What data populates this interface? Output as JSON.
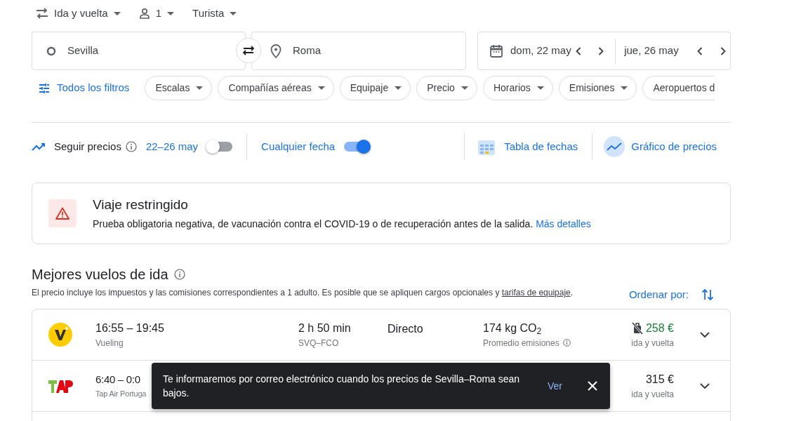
{
  "trip_options": [
    {
      "kind": "trip",
      "label": "Ida y vuelta"
    },
    {
      "kind": "passengers",
      "label": "1"
    },
    {
      "kind": "class",
      "label": "Turista"
    }
  ],
  "origin": {
    "value": "Sevilla"
  },
  "destination": {
    "value": "Roma"
  },
  "dates": {
    "departure": "dom, 22 may",
    "return": "jue, 26 may"
  },
  "filters": {
    "all_filters": "Todos los filtros",
    "chips": [
      "Escalas",
      "Compañías aéreas",
      "Equipaje",
      "Precio",
      "Horarios",
      "Emisiones",
      "Aeropuertos d"
    ]
  },
  "tracking": {
    "label": "Seguir precios",
    "dates": "22–26 may",
    "on": false
  },
  "any_date": {
    "label": "Cualquier fecha",
    "on": true
  },
  "date_grid": "Tabla de fechas",
  "price_graph": "Gráfico de precios",
  "alert": {
    "title": "Viaje restringido",
    "text": "Prueba obligatoria negativa, de vacunación contra el COVID-19 o de recuperación antes de la salida.",
    "link": "Más detalles"
  },
  "section": {
    "title": "Mejores vuelos de ida",
    "note": "El precio incluye los impuestos y las comisiones correspondientes a 1 adulto. Es posible que se apliquen cargos opcionales y",
    "note_link": "tarifas de equipaje",
    "note_end": ".",
    "sort_label": "Ordenar por:"
  },
  "flights": [
    {
      "kind": "badge",
      "times": "16:55 – 19:45",
      "airline": "Vueling",
      "duration": "2 h 50 min",
      "route": "SVQ–FCO",
      "stops": "Directo",
      "emissions": "174 kg CO$_{2}$",
      "emissions_note": "Promedio emisiones",
      "no_bag": true,
      "price_low": true,
      "price": "258 €",
      "price_note": "ida y vuelta"
    },
    {
      "kind": "wordmark",
      "times": "6:40 – 0:0",
      "airline": "Tap Air Portuga",
      "no_bag": false,
      "price_low": false,
      "price": "315 €",
      "price_note": "ida y vuelta"
    }
  ],
  "toast": {
    "text": "Te informaremos por correo electrónico cuando los precios de Sevilla–Roma sean bajos.",
    "action": "Ver"
  }
}
